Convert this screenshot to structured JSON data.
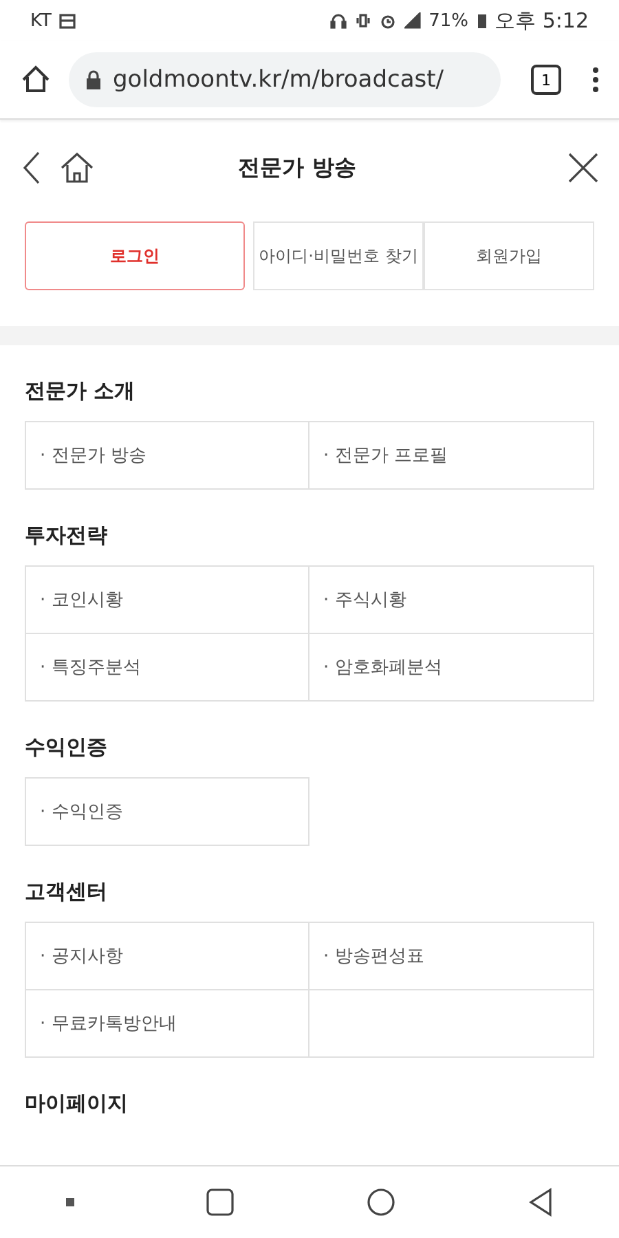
{
  "status_bar": {
    "carrier": "KT",
    "battery": "71%",
    "time": "오후 5:12"
  },
  "browser": {
    "url": "goldmoontv.kr/m/broadcast/",
    "tab_count": "1"
  },
  "header": {
    "title": "전문가 방송"
  },
  "auth_buttons": [
    {
      "label": "로그인",
      "kind": "primary"
    },
    {
      "label": "아이디·비밀번호 찾기",
      "kind": "default"
    },
    {
      "label": "회원가입",
      "kind": "default"
    }
  ],
  "sections": [
    {
      "title": "전문가 소개",
      "items": [
        "· 전문가 방송",
        "· 전문가 프로필"
      ]
    },
    {
      "title": "투자전략",
      "items": [
        "· 코인시황",
        "· 주식시황",
        "· 특징주분석",
        "· 암호화폐분석"
      ]
    },
    {
      "title": "수익인증",
      "items": [
        "· 수익인증"
      ]
    },
    {
      "title": "고객센터",
      "items": [
        "· 공지사항",
        "· 방송편성표",
        "· 무료카톡방안내"
      ]
    },
    {
      "title": "마이페이지"
    }
  ]
}
